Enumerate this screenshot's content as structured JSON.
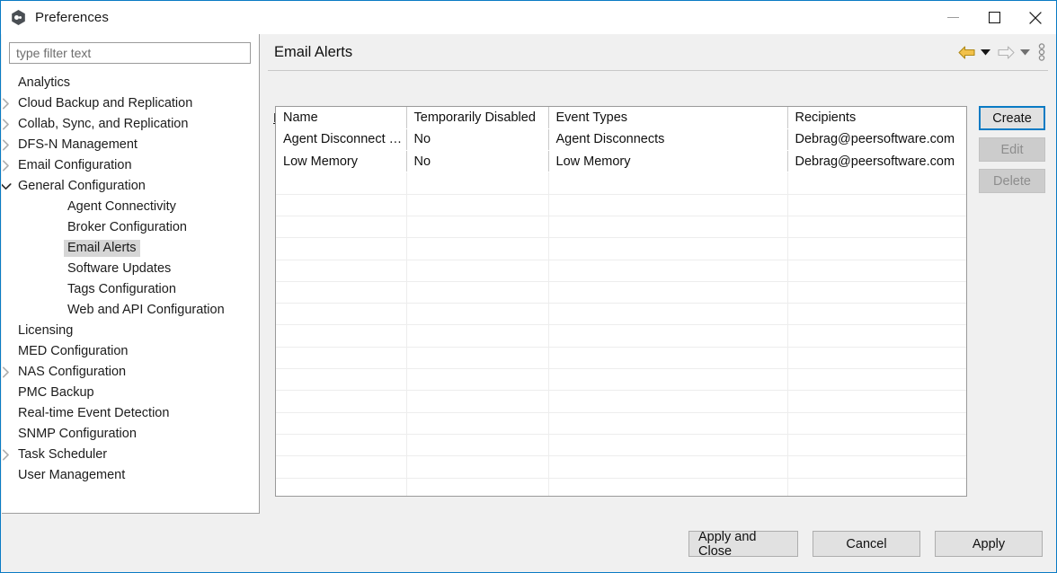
{
  "window": {
    "title": "Preferences",
    "app_icon": "hexagon-app-icon",
    "controls": {
      "minimize": "minimize-icon",
      "maximize": "maximize-icon",
      "close": "close-icon"
    },
    "accent_color": "#0a7bc4"
  },
  "sidebar": {
    "filter": {
      "value": "",
      "placeholder": "type filter text"
    },
    "items": [
      {
        "label": "Analytics",
        "level": 0,
        "twisty": "none",
        "selected": false
      },
      {
        "label": "Cloud Backup and Replication",
        "level": 0,
        "twisty": "collapsed",
        "selected": false
      },
      {
        "label": "Collab, Sync, and Replication",
        "level": 0,
        "twisty": "collapsed",
        "selected": false
      },
      {
        "label": "DFS-N Management",
        "level": 0,
        "twisty": "collapsed",
        "selected": false
      },
      {
        "label": "Email Configuration",
        "level": 0,
        "twisty": "collapsed",
        "selected": false
      },
      {
        "label": "General Configuration",
        "level": 0,
        "twisty": "expanded",
        "selected": false
      },
      {
        "label": "Agent Connectivity",
        "level": 1,
        "twisty": "none",
        "selected": false
      },
      {
        "label": "Broker Configuration",
        "level": 1,
        "twisty": "none",
        "selected": false
      },
      {
        "label": "Email Alerts",
        "level": 1,
        "twisty": "none",
        "selected": true
      },
      {
        "label": "Software Updates",
        "level": 1,
        "twisty": "none",
        "selected": false
      },
      {
        "label": "Tags Configuration",
        "level": 1,
        "twisty": "none",
        "selected": false
      },
      {
        "label": "Web and API Configuration",
        "level": 1,
        "twisty": "none",
        "selected": false
      },
      {
        "label": "Licensing",
        "level": 0,
        "twisty": "none",
        "selected": false
      },
      {
        "label": "MED Configuration",
        "level": 0,
        "twisty": "none",
        "selected": false
      },
      {
        "label": "NAS Configuration",
        "level": 0,
        "twisty": "collapsed",
        "selected": false
      },
      {
        "label": "PMC Backup",
        "level": 0,
        "twisty": "none",
        "selected": false
      },
      {
        "label": "Real-time Event Detection",
        "level": 0,
        "twisty": "none",
        "selected": false
      },
      {
        "label": "SNMP Configuration",
        "level": 0,
        "twisty": "none",
        "selected": false
      },
      {
        "label": "Task Scheduler",
        "level": 0,
        "twisty": "collapsed",
        "selected": false
      },
      {
        "label": "User Management",
        "level": 0,
        "twisty": "none",
        "selected": false
      }
    ]
  },
  "panel": {
    "title": "Email Alerts",
    "toolbar": {
      "back": "back-arrow-icon",
      "back_dropdown": "chevron-down-icon",
      "forward": "forward-arrow-icon",
      "forward_dropdown": "chevron-down-icon",
      "menu": "vertical-dots-icon",
      "back_color": "#e8b020",
      "forward_color": "#bdbdbd"
    },
    "edit_link": "Edit Email Configuration",
    "table": {
      "columns": [
        "Name",
        "Temporarily Disabled",
        "Event Types",
        "Recipients"
      ],
      "rows": [
        [
          "Agent Disconnect …",
          "No",
          "Agent Disconnects",
          "Debrag@peersoftware.com"
        ],
        [
          "Low Memory",
          "No",
          "Low Memory",
          "Debrag@peersoftware.com"
        ]
      ],
      "empty_row_count": 15
    },
    "actions": [
      {
        "label": "Create",
        "state": "focused"
      },
      {
        "label": "Edit",
        "state": "disabled"
      },
      {
        "label": "Delete",
        "state": "disabled"
      }
    ]
  },
  "footer": {
    "buttons": [
      {
        "label": "Apply and Close",
        "id": "apply-close"
      },
      {
        "label": "Cancel",
        "id": "cancel"
      },
      {
        "label": "Apply",
        "id": "apply"
      }
    ]
  }
}
